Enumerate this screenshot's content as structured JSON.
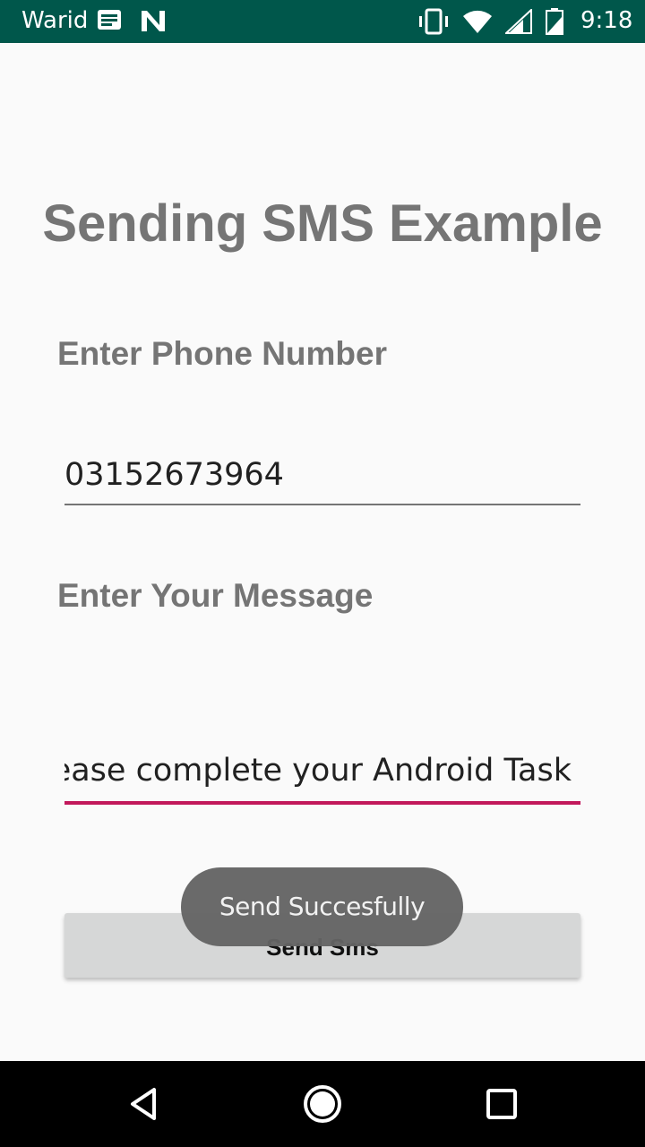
{
  "status_bar": {
    "carrier": "Warid",
    "time": "9:18",
    "icons": [
      "notes-icon",
      "n-logo-icon",
      "vibrate-icon",
      "wifi-icon",
      "signal-icon",
      "battery-icon"
    ]
  },
  "main": {
    "title": "Sending SMS Example",
    "phone_label": "Enter Phone Number",
    "phone_value": "03152673964",
    "message_label": "Enter Your Message",
    "message_value": "Please complete your Android Task",
    "send_button_label": "Send Sms"
  },
  "toast": {
    "text": "Send Succesfully"
  },
  "nav_bar": {
    "icons": [
      "back-icon",
      "home-icon",
      "recents-icon"
    ]
  },
  "colors": {
    "status_bar": "#00574b",
    "accent": "#c2185b",
    "label_text": "#757575",
    "button_bg": "#d6d7d7"
  }
}
